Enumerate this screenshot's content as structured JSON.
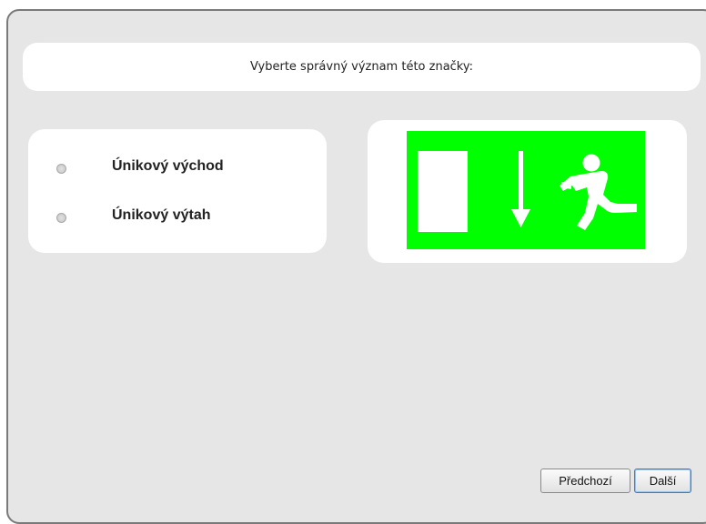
{
  "question": {
    "text": "Vyberte správný význam této značky:"
  },
  "answers": [
    {
      "label": "Únikový východ",
      "selected": false
    },
    {
      "label": "Únikový výtah",
      "selected": false
    }
  ],
  "sign": {
    "icon": "emergency-exit-sign",
    "background_color": "#00ff00",
    "symbol_color": "#ffffff"
  },
  "navigation": {
    "prev_label": "Předchozí",
    "next_label": "Další"
  }
}
